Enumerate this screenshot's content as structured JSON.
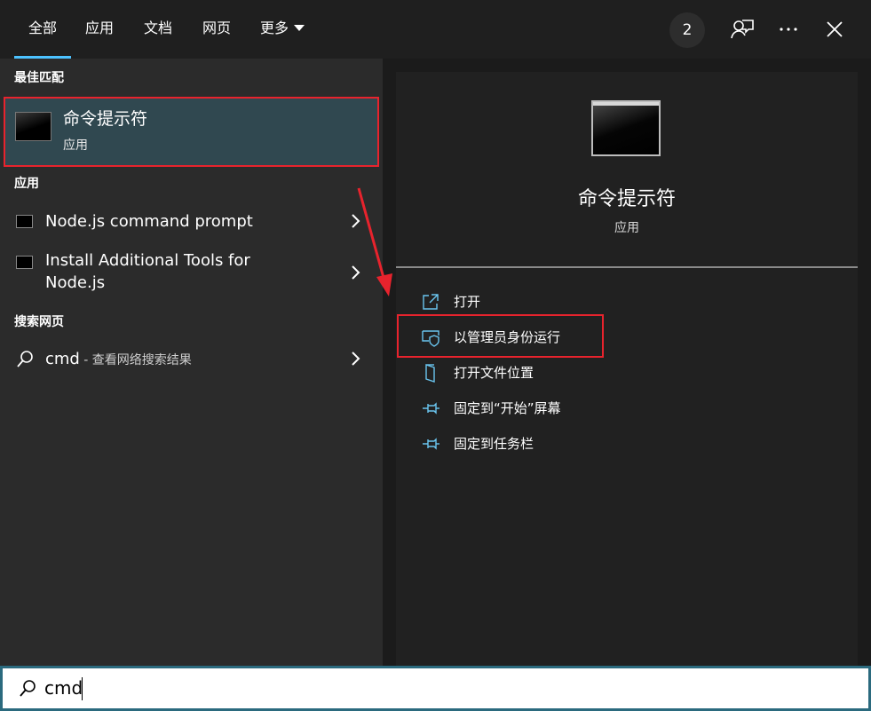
{
  "tabs": [
    {
      "label": "全部"
    },
    {
      "label": "应用"
    },
    {
      "label": "文档"
    },
    {
      "label": "网页"
    },
    {
      "label": "更多"
    }
  ],
  "header": {
    "badge": "2"
  },
  "sections": {
    "best_match": "最佳匹配",
    "apps": "应用",
    "web": "搜索网页"
  },
  "best_match": {
    "title": "命令提示符",
    "subtitle": "应用"
  },
  "apps": [
    {
      "label": "Node.js command prompt"
    },
    {
      "label_line1": "Install Additional Tools for",
      "label_line2": "Node.js"
    }
  ],
  "web_result": {
    "query": "cmd",
    "suffix": " - 查看网络搜索结果"
  },
  "preview": {
    "title": "命令提示符",
    "subtitle": "应用",
    "actions": [
      {
        "label": "打开",
        "icon": "open-icon"
      },
      {
        "label": "以管理员身份运行",
        "icon": "shield-icon"
      },
      {
        "label": "打开文件位置",
        "icon": "folder-icon"
      },
      {
        "label": "固定到“开始”屏幕",
        "icon": "pin-icon"
      },
      {
        "label": "固定到任务栏",
        "icon": "pin-icon"
      }
    ]
  },
  "search": {
    "value": "cmd",
    "icon": "search-icon"
  },
  "colors": {
    "accent": "#4cc2ff",
    "highlight_border": "#e8232d",
    "selected_bg": "#304850"
  }
}
